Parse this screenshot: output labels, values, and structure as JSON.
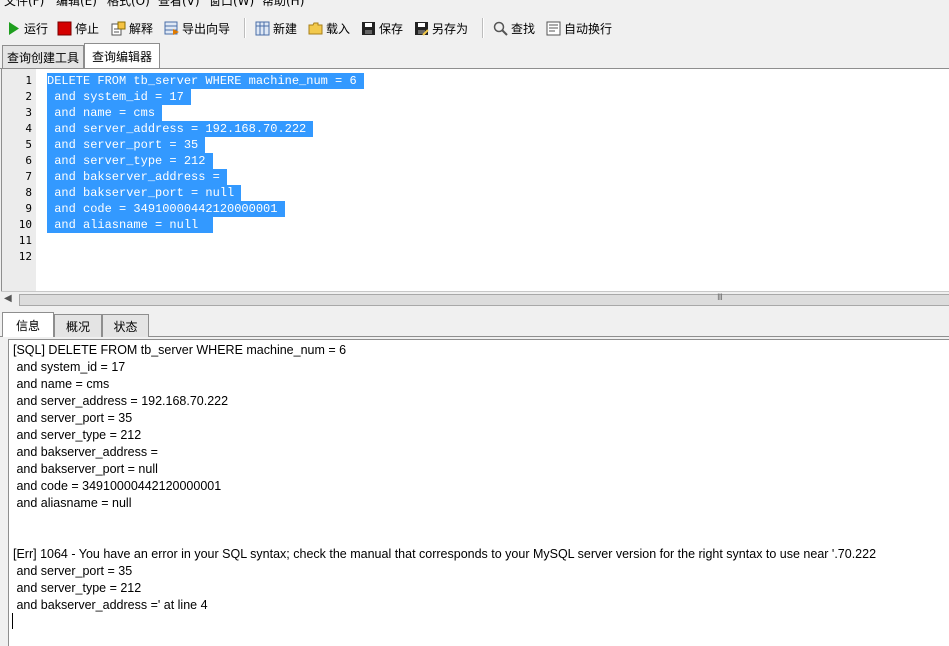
{
  "menu": {
    "items": [
      "文件(F)",
      "编辑(E)",
      "格式(O)",
      "查看(V)",
      "窗口(W)",
      "帮助(H)"
    ]
  },
  "toolbar": {
    "run": "运行",
    "stop": "停止",
    "explain": "解释",
    "export_wizard": "导出向导",
    "new": "新建",
    "load": "载入",
    "save": "保存",
    "save_as": "另存为",
    "find": "查找",
    "word_wrap": "自动换行"
  },
  "top_tabs": [
    "查询创建工具",
    "查询编辑器"
  ],
  "editor": {
    "line_numbers": [
      "1",
      "2",
      "3",
      "4",
      "5",
      "6",
      "7",
      "8",
      "9",
      "10",
      "11",
      "12"
    ],
    "lines": [
      "DELETE FROM tb_server WHERE machine_num = 6 ",
      " and system_id = 17 ",
      " and name = cms ",
      " and server_address = 192.168.70.222 ",
      " and server_port = 35 ",
      " and server_type = 212 ",
      " and bakserver_address = ",
      " and bakserver_port = null ",
      " and code = 34910000442120000001 ",
      " and aliasname = null  ",
      "",
      ""
    ]
  },
  "scrollbar": {
    "grip": "III"
  },
  "bottom_tabs": [
    "信息",
    "概况",
    "状态"
  ],
  "output": {
    "lines": [
      "[SQL] DELETE FROM tb_server WHERE machine_num = 6",
      " and system_id = 17",
      " and name = cms",
      " and server_address = 192.168.70.222",
      " and server_port = 35",
      " and server_type = 212",
      " and bakserver_address =",
      " and bakserver_port = null",
      " and code = 34910000442120000001",
      " and aliasname = null",
      "",
      "",
      "[Err] 1064 - You have an error in your SQL syntax; check the manual that corresponds to your MySQL server version for the right syntax to use near '.70.222",
      " and server_port = 35",
      " and server_type = 212",
      " and bakserver_address =' at line 4"
    ]
  },
  "colors": {
    "selection": "#3399ff",
    "run_icon": "#1e9e1e",
    "stop_icon": "#d40000"
  }
}
